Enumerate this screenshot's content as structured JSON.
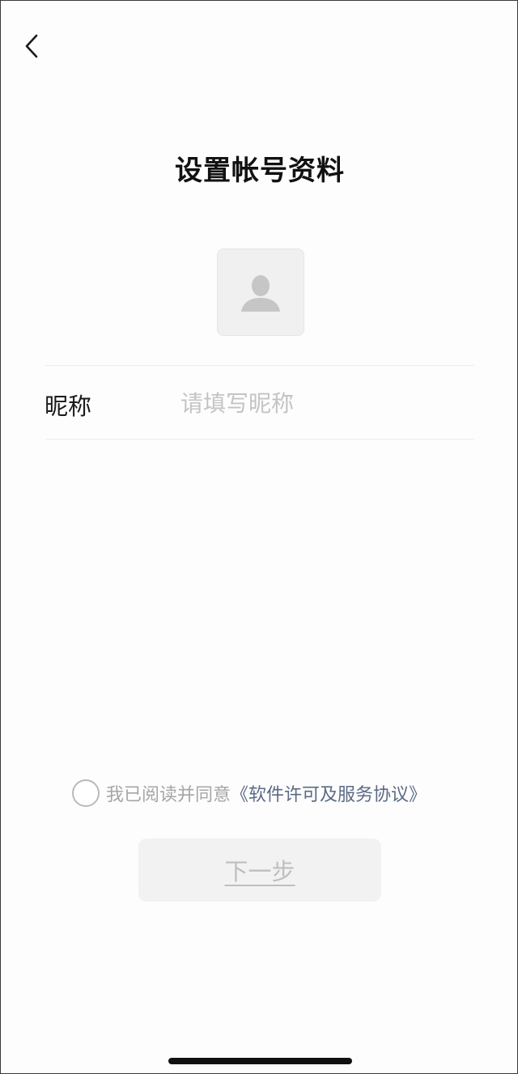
{
  "header": {
    "back_icon": "chevron-left-icon",
    "title": "设置帐号资料"
  },
  "avatar": {
    "icon": "person-silhouette-icon",
    "background": "#f0f0f0"
  },
  "form": {
    "nickname": {
      "label": "昵称",
      "value": "",
      "placeholder": "请填写昵称"
    }
  },
  "agreement": {
    "checked": false,
    "text": "我已阅读并同意",
    "link": "《软件许可及服务协议》",
    "link_color": "#5c6a86"
  },
  "next_button": {
    "label": "下一步",
    "enabled": false
  }
}
